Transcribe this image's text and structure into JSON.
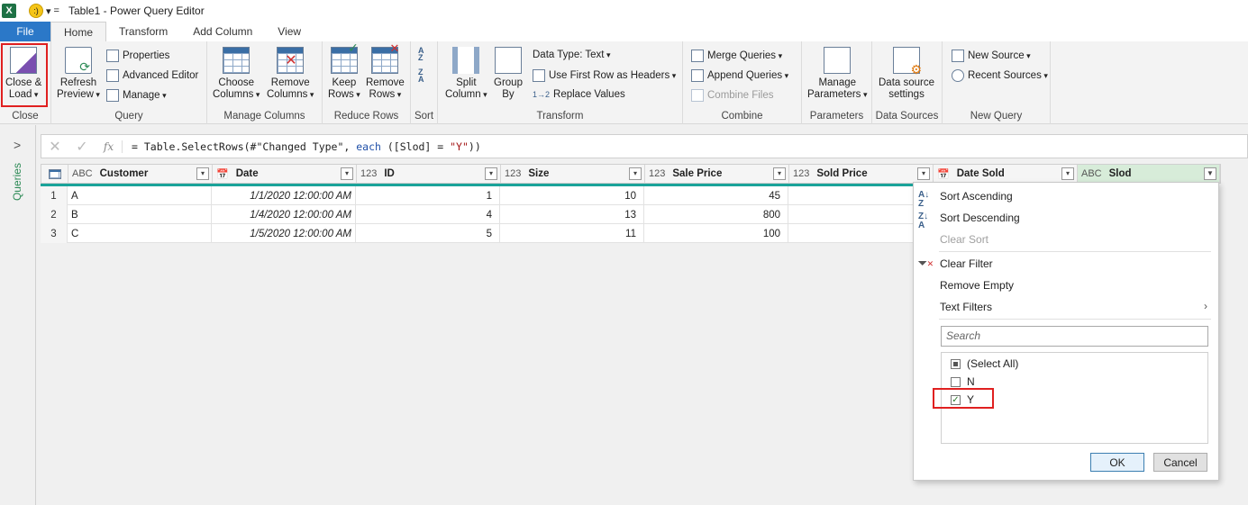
{
  "window": {
    "title": "Table1 - Power Query Editor",
    "app_icon_letter": "X",
    "qat_smiley": ":)",
    "qat_dropdown": "▾",
    "qat_customize": "="
  },
  "tabs": [
    {
      "label": "File"
    },
    {
      "label": "Home"
    },
    {
      "label": "Transform"
    },
    {
      "label": "Add Column"
    },
    {
      "label": "View"
    }
  ],
  "ribbon": {
    "close": {
      "btn_line1": "Close &",
      "btn_line2": "Load",
      "group": "Close"
    },
    "query": {
      "refresh1": "Refresh",
      "refresh2": "Preview",
      "properties": "Properties",
      "advanced_editor": "Advanced Editor",
      "manage": "Manage",
      "group": "Query"
    },
    "manage_columns": {
      "choose1": "Choose",
      "choose2": "Columns",
      "remove1": "Remove",
      "remove2": "Columns",
      "group": "Manage Columns"
    },
    "reduce_rows": {
      "keep1": "Keep",
      "keep2": "Rows",
      "remove1": "Remove",
      "remove2": "Rows",
      "group": "Reduce Rows"
    },
    "sort": {
      "asc_top": "A",
      "asc_bot": "Z",
      "desc_top": "Z",
      "desc_bot": "A",
      "group": "Sort"
    },
    "transform": {
      "split1": "Split",
      "split2": "Column",
      "group1": "Group",
      "group2": "By",
      "data_type": "Data Type: Text",
      "first_row": "Use First Row as Headers",
      "replace": "Replace Values",
      "replace_icon": "1→2",
      "group": "Transform"
    },
    "combine": {
      "merge": "Merge Queries",
      "append": "Append Queries",
      "combine_files": "Combine Files",
      "group": "Combine"
    },
    "parameters": {
      "manage1": "Manage",
      "manage2": "Parameters",
      "group": "Parameters"
    },
    "data_sources": {
      "settings1": "Data source",
      "settings2": "settings",
      "group": "Data Sources"
    },
    "new_query": {
      "new_source": "New Source",
      "recent_sources": "Recent Sources",
      "group": "New Query"
    }
  },
  "sidebar": {
    "label": "Queries",
    "chevron": ">"
  },
  "formula_bar": {
    "cancel": "✕",
    "confirm": "✓",
    "fx": "fx",
    "prefix": "= Table.SelectRows(#\"Changed Type\", ",
    "keyword": "each",
    "middle": " ([Slod] = ",
    "string": "\"Y\"",
    "suffix": "))"
  },
  "table": {
    "columns": [
      {
        "type": "ABC",
        "name": "Customer"
      },
      {
        "type": "📅",
        "name": "Date"
      },
      {
        "type": "123",
        "name": "ID"
      },
      {
        "type": "123",
        "name": "Size"
      },
      {
        "type": "123",
        "name": "Sale Price"
      },
      {
        "type": "123",
        "name": "Sold Price"
      },
      {
        "type": "📅",
        "name": "Date Sold"
      },
      {
        "type": "ABC",
        "name": "Slod"
      }
    ],
    "rows": [
      {
        "n": "1",
        "customer": "A",
        "date": "1/1/2020 12:00:00 AM",
        "id": "1",
        "size": "10",
        "sale_price": "45"
      },
      {
        "n": "2",
        "customer": "B",
        "date": "1/4/2020 12:00:00 AM",
        "id": "4",
        "size": "13",
        "sale_price": "800"
      },
      {
        "n": "3",
        "customer": "C",
        "date": "1/5/2020 12:00:00 AM",
        "id": "5",
        "size": "11",
        "sale_price": "100"
      }
    ]
  },
  "filter_menu": {
    "sort_ascending": "Sort Ascending",
    "sort_descending": "Sort Descending",
    "clear_sort": "Clear Sort",
    "clear_filter": "Clear Filter",
    "remove_empty": "Remove Empty",
    "text_filters": "Text Filters",
    "text_filters_arrow": "›",
    "search_placeholder": "Search",
    "options": [
      {
        "label": "(Select All)",
        "state": "partial"
      },
      {
        "label": "N",
        "state": "unchecked"
      },
      {
        "label": "Y",
        "state": "checked"
      }
    ],
    "checkmark": "✓",
    "ok": "OK",
    "cancel": "Cancel"
  },
  "colors": {
    "accent": "#2b78c8",
    "highlight": "#e02020",
    "teal": "#1aa39a"
  }
}
